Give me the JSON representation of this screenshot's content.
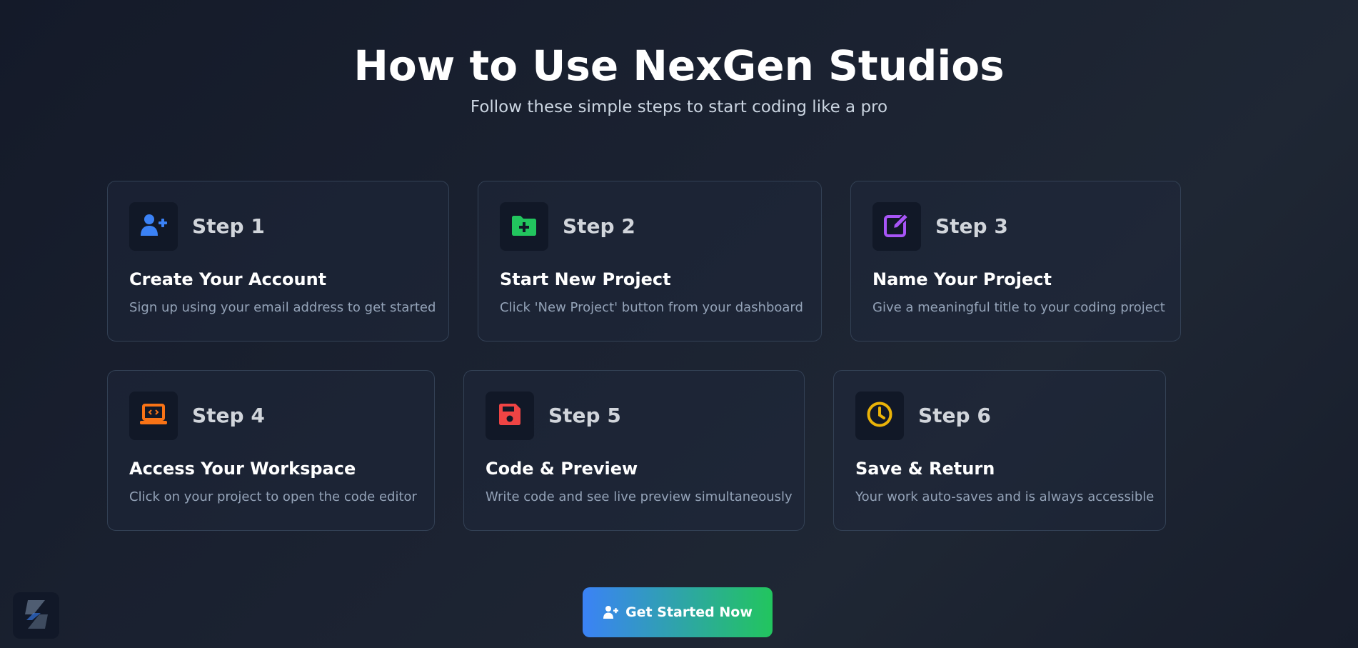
{
  "hero": {
    "title": "How to Use NexGen Studios",
    "subtitle": "Follow these simple steps to start coding like a pro"
  },
  "steps": [
    {
      "label": "Step 1",
      "title": "Create Your Account",
      "description": "Sign up using your email address to get started",
      "icon": "user-plus-icon",
      "icon_color": "#3b82f6"
    },
    {
      "label": "Step 2",
      "title": "Start New Project",
      "description": "Click 'New Project' button from your dashboard",
      "icon": "folder-plus-icon",
      "icon_color": "#22c55e"
    },
    {
      "label": "Step 3",
      "title": "Name Your Project",
      "description": "Give a meaningful title to your coding project",
      "icon": "edit-icon",
      "icon_color": "#a855f7"
    },
    {
      "label": "Step 4",
      "title": "Access Your Workspace",
      "description": "Click on your project to open the code editor",
      "icon": "laptop-code-icon",
      "icon_color": "#f97316"
    },
    {
      "label": "Step 5",
      "title": "Code & Preview",
      "description": "Write code and see live preview simultaneously",
      "icon": "save-icon",
      "icon_color": "#ef4444"
    },
    {
      "label": "Step 6",
      "title": "Save & Return",
      "description": "Your work auto-saves and is always accessible",
      "icon": "clock-icon",
      "icon_color": "#eab308"
    }
  ],
  "cta": {
    "label": "Get Started Now",
    "icon": "user-plus-icon"
  },
  "badge": {
    "icon": "app-logo-icon"
  },
  "colors": {
    "background_dark": "#141a29",
    "card_border": "#334155",
    "cta_start": "#3b82f6",
    "cta_end": "#22c55e"
  }
}
